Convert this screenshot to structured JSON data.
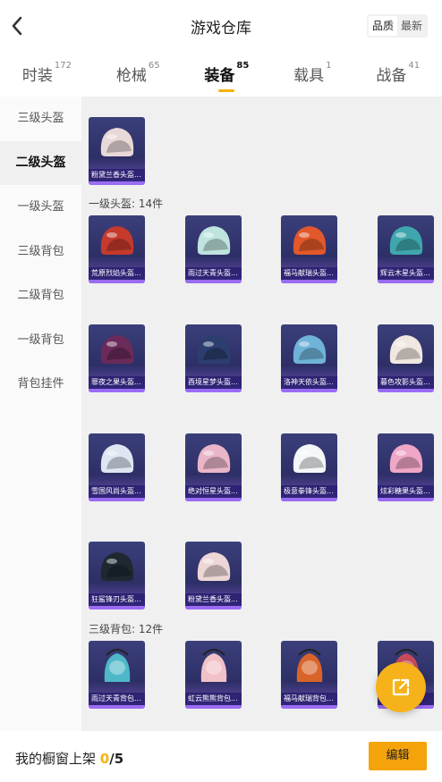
{
  "header": {
    "title": "游戏仓库",
    "sort_quality": "品质",
    "sort_latest": "最新"
  },
  "tabs": [
    {
      "label": "时装",
      "count": "172"
    },
    {
      "label": "枪械",
      "count": "65"
    },
    {
      "label": "装备",
      "count": "85"
    },
    {
      "label": "载具",
      "count": "1"
    },
    {
      "label": "战备",
      "count": "41"
    }
  ],
  "sidebar": [
    {
      "label": "三级头盔"
    },
    {
      "label": "二级头盔"
    },
    {
      "label": "一级头盔"
    },
    {
      "label": "三级背包"
    },
    {
      "label": "二级背包"
    },
    {
      "label": "一级背包"
    },
    {
      "label": "背包挂件"
    }
  ],
  "groups": {
    "level1_helmet": "一级头盔: 14件",
    "level3_backpack": "三级背包: 12件"
  },
  "items": {
    "top": [
      {
        "name": "粉黛兰香头盔..."
      }
    ],
    "helmets": [
      {
        "name": "荒原烈焰头盔..."
      },
      {
        "name": "雨过天青头盔..."
      },
      {
        "name": "福马献瑞头盔..."
      },
      {
        "name": "辉云木星头盔..."
      },
      {
        "name": "罪夜之果头盔..."
      },
      {
        "name": "酉境星梦头盔..."
      },
      {
        "name": "洛神天依头盔..."
      },
      {
        "name": "暮色攻影头盔..."
      },
      {
        "name": "雪国风尚头盔..."
      },
      {
        "name": "绝对恒星头盔..."
      },
      {
        "name": "极意拳锋头盔..."
      },
      {
        "name": "炫彩糖果头盔..."
      },
      {
        "name": "狂鲨锋刃头盔..."
      },
      {
        "name": "粉黛兰香头盔..."
      }
    ],
    "backpacks": [
      {
        "name": "雨过天青背包..."
      },
      {
        "name": "虹云熊熊背包..."
      },
      {
        "name": "福马献瑞背包..."
      },
      {
        "name": ""
      }
    ]
  },
  "bottom": {
    "showcase_label": "我的橱窗上架",
    "showcase_count": "0",
    "showcase_total": "/5",
    "edit_label": "编辑"
  },
  "colors": {
    "accent": "#f5b20b",
    "card_bg": "#2d2f66",
    "card_bar": "#9b6cf3"
  }
}
